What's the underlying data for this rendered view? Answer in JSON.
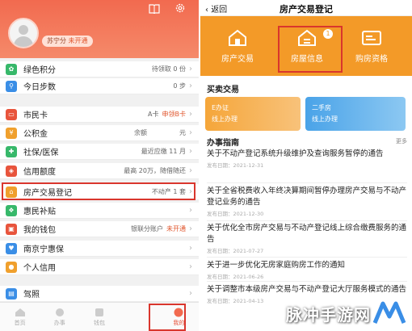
{
  "left": {
    "user_tag_prefix": "苏宁分",
    "user_tag_status": "未开通",
    "menu": [
      {
        "label": "绿色积分",
        "value": "待领取 0 份",
        "icon": "leaf-icon",
        "color": "#37b86a"
      },
      {
        "label": "今日步数",
        "value": "0 步",
        "icon": "walk-icon",
        "color": "#3a8ee6"
      },
      {
        "label": "市民卡",
        "value": "A卡",
        "value2": "申领B卡",
        "icon": "card-icon",
        "color": "#e8543c"
      },
      {
        "label": "公积金",
        "value": "余额",
        "value2": "元",
        "icon": "fund-icon",
        "color": "#f0a02d"
      },
      {
        "label": "社保/医保",
        "value": "最近应缴 11 月",
        "icon": "shield-icon",
        "color": "#37b86a"
      },
      {
        "label": "信用额度",
        "value": "最高 20万，随借随还",
        "icon": "credit-icon",
        "color": "#e8543c"
      },
      {
        "label": "房产交易登记",
        "value": "不动产 1 套",
        "icon": "house-icon",
        "color": "#f0a02d"
      },
      {
        "label": "惠民补贴",
        "value": "",
        "icon": "subsidy-icon",
        "color": "#37b86a"
      },
      {
        "label": "我的钱包",
        "value": "银联分账户",
        "value2": "未开通",
        "icon": "wallet-icon",
        "color": "#e8543c"
      },
      {
        "label": "南京宁惠保",
        "value": "",
        "icon": "insurance-icon",
        "color": "#3a8ee6"
      },
      {
        "label": "个人信用",
        "value": "",
        "icon": "person-icon",
        "color": "#f0a02d"
      },
      {
        "label": "驾照",
        "value": "",
        "icon": "license-icon",
        "color": "#3a8ee6"
      }
    ],
    "tabs": [
      {
        "label": "首页",
        "icon": "home-icon"
      },
      {
        "label": "办事",
        "icon": "service-icon"
      },
      {
        "label": "钱包",
        "icon": "wallet-tab-icon"
      },
      {
        "label": "",
        "icon": "blank-tab-icon"
      },
      {
        "label": "我的",
        "icon": "profile-icon"
      }
    ]
  },
  "right": {
    "back_label": "返回",
    "title": "房产交易登记",
    "nav": [
      {
        "label": "房产交易",
        "icon": "house-trade-icon"
      },
      {
        "label": "房屋信息",
        "icon": "house-info-icon"
      },
      {
        "label": "购房资格",
        "icon": "buy-qualify-icon"
      }
    ],
    "badge": "1",
    "section_trade": "买卖交易",
    "cards": [
      {
        "line1": "E办证",
        "line2": "线上办理"
      },
      {
        "line1": "二手房",
        "line2": "线上办理"
      }
    ],
    "section_guide": "办事指南",
    "more_label": "更多",
    "news": [
      {
        "title": "关于不动产登记系统升级维护及查询服务暂停的通告",
        "date": "发布日期：2021-12-31"
      },
      {
        "title": "关于全省税费收入年终决算期间暂停办理房产交易与不动产登记业务的通告",
        "date": "发布日期：2021-12-30"
      },
      {
        "title": "关于优化全市房产交易与不动产登记线上综合缴费服务的通告",
        "date": "发布日期：2021-07-27"
      },
      {
        "title": "关于进一步优化无房家庭购房工作的通知",
        "date": "发布日期：2021-06-26"
      },
      {
        "title": "关于调整市本级房产交易与不动产登记大厅服务模式的通告",
        "date": "发布日期：2021-04-13"
      }
    ]
  },
  "watermark": "脉冲手游网"
}
